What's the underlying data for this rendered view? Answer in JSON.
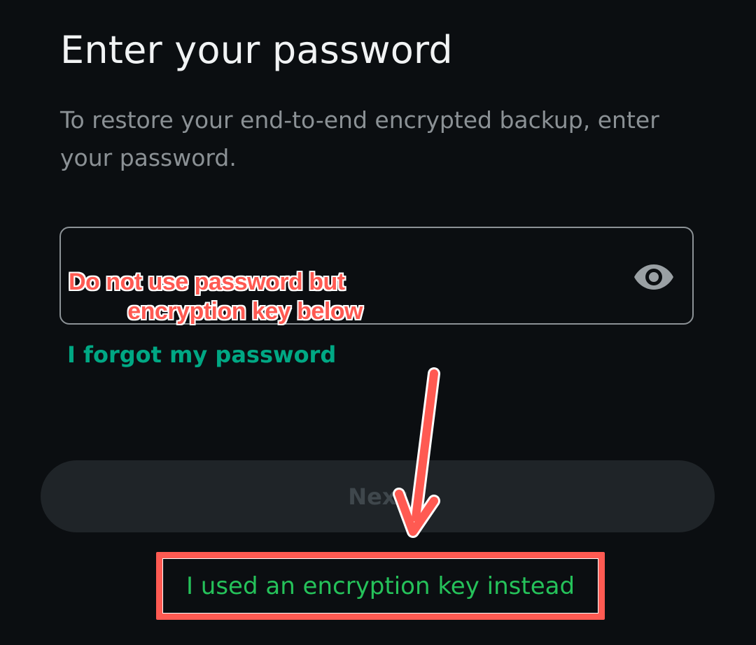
{
  "screen": {
    "title": "Enter your password",
    "subtitle": "To restore your end-to-end encrypted backup, enter your password."
  },
  "password_field": {
    "value": "",
    "toggle_icon": "eye-icon"
  },
  "links": {
    "forgot_password": "I forgot my password",
    "use_encryption_key": "I used an encryption key instead"
  },
  "buttons": {
    "next_label": "Next"
  },
  "annotation": {
    "note_line1": "Do not use password but",
    "note_line2": "encryption key below",
    "color": "#ff5a52"
  },
  "colors": {
    "background": "#0b0e11",
    "accent_green": "#00a884",
    "link_green": "#25c25a",
    "annotation_red": "#ff5a52"
  }
}
